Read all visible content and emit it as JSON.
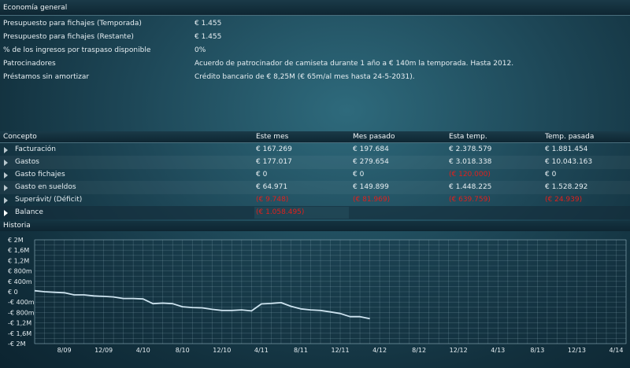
{
  "economy": {
    "header": "Economía general",
    "rows": [
      {
        "label": "Presupuesto para fichajes (Temporada)",
        "value": "€ 1.455"
      },
      {
        "label": "Presupuesto para fichajes (Restante)",
        "value": "€ 1.455"
      },
      {
        "label": "% de los ingresos por traspaso disponible",
        "value": "0%"
      },
      {
        "label": "Patrocinadores",
        "value": "Acuerdo de patrocinador de camiseta durante 1 año a € 140m la temporada. Hasta 2012."
      },
      {
        "label": "Préstamos sin amortizar",
        "value": "Crédito bancario de € 8,25M (€ 65m/al mes hasta 24-5-2031)."
      }
    ]
  },
  "finance_table": {
    "headers": [
      "Concepto",
      "Este mes",
      "Mes pasado",
      "Esta temp.",
      "Temp. pasada"
    ],
    "rows": [
      {
        "concept": "Facturación",
        "this_month": "€ 167.269",
        "last_month": "€ 197.684",
        "this_season": "€ 2.378.579",
        "last_season": "€ 1.881.454"
      },
      {
        "concept": "Gastos",
        "this_month": "€ 177.017",
        "last_month": "€ 279.654",
        "this_season": "€ 3.018.338",
        "last_season": "€ 10.043.163"
      },
      {
        "concept": "Gasto fichajes",
        "this_month": "€ 0",
        "last_month": "€ 0",
        "this_season": "(€ 120.000)",
        "last_season": "€ 0"
      },
      {
        "concept": "Gasto en sueldos",
        "this_month": "€ 64.971",
        "last_month": "€ 149.899",
        "this_season": "€ 1.448.225",
        "last_season": "€ 1.528.292"
      },
      {
        "concept": "Superávit/ (Déficit)",
        "this_month": "(€ 9.748)",
        "last_month": "(€ 81.969)",
        "this_season": "(€ 639.759)",
        "last_season": "(€ 24.939)"
      }
    ],
    "balance": {
      "label": "Balance",
      "value": "(€ 1.058.495)"
    }
  },
  "history": {
    "title": "Historia",
    "chart_data": {
      "type": "line",
      "title": "",
      "xlabel": "",
      "ylabel": "",
      "ylim": [
        -2000000,
        2000000
      ],
      "y_ticks": [
        {
          "value": 2000000,
          "label": "€ 2M"
        },
        {
          "value": 1600000,
          "label": "€ 1,6M"
        },
        {
          "value": 1200000,
          "label": "€ 1,2M"
        },
        {
          "value": 800000,
          "label": "€ 800m"
        },
        {
          "value": 400000,
          "label": "€ 400m"
        },
        {
          "value": 0,
          "label": "€ 0"
        },
        {
          "value": -400000,
          "label": "-€ 400m"
        },
        {
          "value": -800000,
          "label": "-€ 800m"
        },
        {
          "value": -1200000,
          "label": "-€ 1,2M"
        },
        {
          "value": -1600000,
          "label": "-€ 1,6M"
        },
        {
          "value": -2000000,
          "label": "-€ 2M"
        }
      ],
      "x_ticks": [
        "8/09",
        "12/09",
        "4/10",
        "8/10",
        "12/10",
        "4/11",
        "8/11",
        "12/11",
        "4/12",
        "8/12",
        "12/12",
        "4/13",
        "8/13",
        "12/13",
        "4/14"
      ],
      "x_range": [
        "2009-05",
        "2014-05"
      ],
      "grid": true,
      "series": [
        {
          "color": "#cde3ef",
          "points": [
            [
              "2009-05",
              40000
            ],
            [
              "2009-06",
              0
            ],
            [
              "2009-07",
              -20000
            ],
            [
              "2009-08",
              -40000
            ],
            [
              "2009-09",
              -120000
            ],
            [
              "2009-10",
              -120000
            ],
            [
              "2009-11",
              -160000
            ],
            [
              "2009-12",
              -180000
            ],
            [
              "2010-01",
              -200000
            ],
            [
              "2010-02",
              -260000
            ],
            [
              "2010-03",
              -260000
            ],
            [
              "2010-04",
              -280000
            ],
            [
              "2010-05",
              -460000
            ],
            [
              "2010-06",
              -440000
            ],
            [
              "2010-07",
              -460000
            ],
            [
              "2010-08",
              -580000
            ],
            [
              "2010-09",
              -610000
            ],
            [
              "2010-10",
              -620000
            ],
            [
              "2010-11",
              -680000
            ],
            [
              "2010-12",
              -720000
            ],
            [
              "2011-01",
              -720000
            ],
            [
              "2011-02",
              -700000
            ],
            [
              "2011-03",
              -740000
            ],
            [
              "2011-04",
              -470000
            ],
            [
              "2011-05",
              -450000
            ],
            [
              "2011-06",
              -420000
            ],
            [
              "2011-07",
              -560000
            ],
            [
              "2011-08",
              -660000
            ],
            [
              "2011-09",
              -700000
            ],
            [
              "2011-10",
              -720000
            ],
            [
              "2011-11",
              -780000
            ],
            [
              "2011-12",
              -840000
            ],
            [
              "2012-01",
              -960000
            ],
            [
              "2012-02",
              -960000
            ],
            [
              "2012-03",
              -1040000
            ]
          ]
        }
      ]
    }
  }
}
